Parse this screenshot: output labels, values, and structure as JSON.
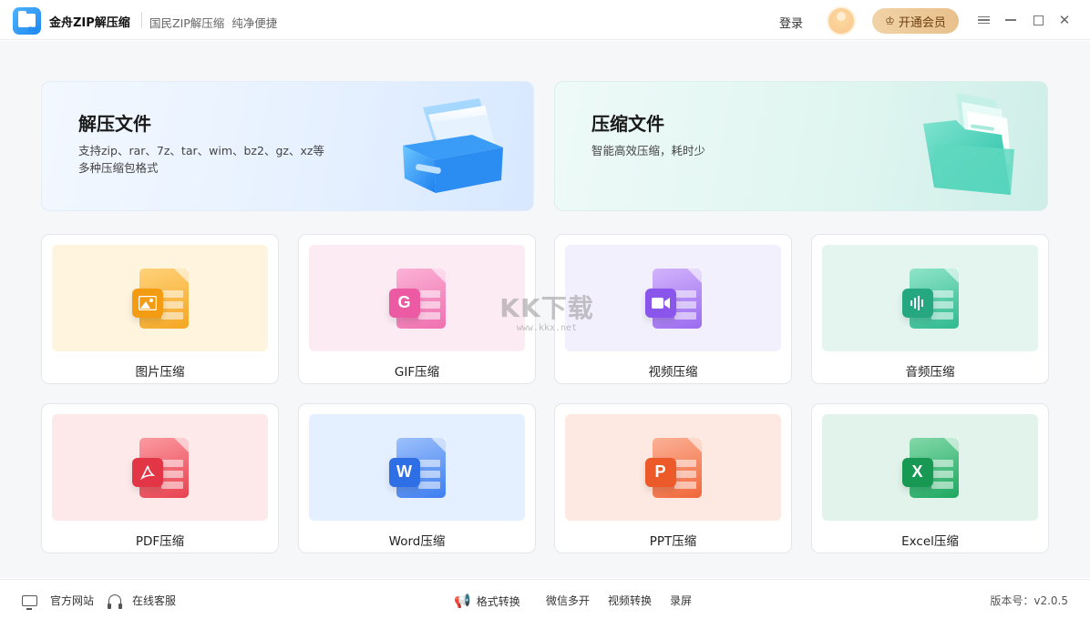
{
  "titlebar": {
    "app_name": "金舟ZIP解压缩",
    "slogan": "国民ZIP解压缩  纯净便捷",
    "login_label": "登录",
    "vip_label": "开通会员",
    "vip_icon": "crown-icon"
  },
  "hero": {
    "unzip": {
      "title": "解压文件",
      "desc_line1": "支持zip、rar、7z、tar、wim、bz2、gz、xz等",
      "desc_line2": "多种压缩包格式"
    },
    "zip": {
      "title": "压缩文件",
      "desc": "智能高效压缩，耗时少"
    }
  },
  "tools": [
    {
      "label": "图片压缩",
      "icon": "image-file-icon",
      "bg": "#fff4dd",
      "color": "#f5a623"
    },
    {
      "label": "GIF压缩",
      "icon": "gif-file-icon",
      "bg": "#fdebf3",
      "color": "#ef6fb0",
      "badge": "G"
    },
    {
      "label": "视频压缩",
      "icon": "video-file-icon",
      "bg": "#f3f0fd",
      "color": "#9b6bf0"
    },
    {
      "label": "音频压缩",
      "icon": "audio-file-icon",
      "bg": "#e4f5f0",
      "color": "#2fb98e"
    },
    {
      "label": "PDF压缩",
      "icon": "pdf-file-icon",
      "bg": "#fde9ea",
      "color": "#e8424f"
    },
    {
      "label": "Word压缩",
      "icon": "word-file-icon",
      "bg": "#e4efff",
      "color": "#3d7ef0",
      "badge": "W"
    },
    {
      "label": "PPT压缩",
      "icon": "ppt-file-icon",
      "bg": "#fde9e2",
      "color": "#f0673a",
      "badge": "P"
    },
    {
      "label": "Excel压缩",
      "icon": "excel-file-icon",
      "bg": "#e1f3ea",
      "color": "#1ea860",
      "badge": "X"
    }
  ],
  "watermark": {
    "main": "KK下载",
    "sub": "www.kkx.net"
  },
  "statusbar": {
    "official_site": "官方网站",
    "online_service": "在线客服",
    "format_convert": "格式转换",
    "wechat_multi": "微信多开",
    "video_convert": "视频转换",
    "screen_record": "录屏",
    "version": "版本号：v2.0.5"
  }
}
